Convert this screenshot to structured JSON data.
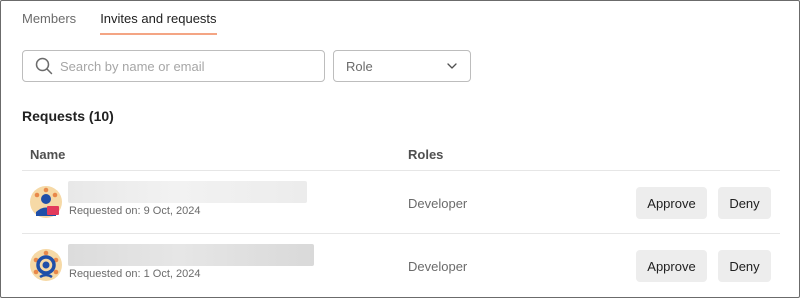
{
  "tabs": [
    {
      "label": "Members",
      "active": false
    },
    {
      "label": "Invites and requests",
      "active": true
    }
  ],
  "search": {
    "placeholder": "Search by name or email",
    "icon": "search-icon"
  },
  "role_filter": {
    "value": "Role",
    "icon": "chevron-down-icon"
  },
  "section": {
    "title": "Requests (10)"
  },
  "table": {
    "columns": [
      "Name",
      "Roles"
    ],
    "rows": [
      {
        "requested": "Requested on: 9 Oct, 2024",
        "role": "Developer",
        "approve": "Approve",
        "deny": "Deny"
      },
      {
        "requested": "Requested on: 1 Oct, 2024",
        "role": "Developer",
        "approve": "Approve",
        "deny": "Deny"
      }
    ]
  },
  "colors": {
    "accent": "#f4a584",
    "button_bg": "#ededed",
    "border": "#bdbdbd"
  }
}
